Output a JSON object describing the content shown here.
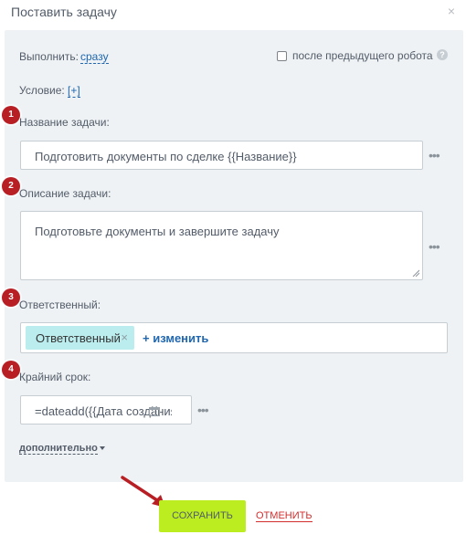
{
  "dialog": {
    "title": "Поставить задачу",
    "close_glyph": "×"
  },
  "form": {
    "execute_label": "Выполнить:",
    "execute_value": "сразу",
    "after_prev_label": "после предыдущего робота",
    "after_prev_checked": false,
    "help_glyph": "?",
    "condition_label": "Условие:",
    "condition_add": "[+]",
    "task_name": {
      "badge": "1",
      "label": "Название задачи:",
      "value": "Подготовить документы по сделке {{Название}}"
    },
    "task_description": {
      "badge": "2",
      "label": "Описание задачи:",
      "value": "Подготовьте документы и завершите задачу"
    },
    "responsible": {
      "badge": "3",
      "label": "Ответственный:",
      "chip": "Ответственный",
      "chip_remove": "×",
      "change": "+ изменить"
    },
    "deadline": {
      "badge": "4",
      "label": "Крайний срок:",
      "value": "=dateadd({{Дата создания"
    },
    "more": "дополнительно",
    "dots": "•••"
  },
  "actions": {
    "save": "СОХРАНИТЬ",
    "cancel": "ОТМЕНИТЬ"
  },
  "colors": {
    "save_bg": "#bbed21",
    "cancel": "#d22e2e",
    "badge": "#b81f24",
    "link": "#2067b0",
    "panel_bg": "#eef2f4",
    "chip_bg": "#bcedee",
    "arrow": "#b81f24"
  },
  "icons": [
    "close-icon",
    "help-icon",
    "calendar-icon",
    "more-dots-icon",
    "chevron-down-icon",
    "resize-handle-icon",
    "pointer-arrow-icon"
  ]
}
